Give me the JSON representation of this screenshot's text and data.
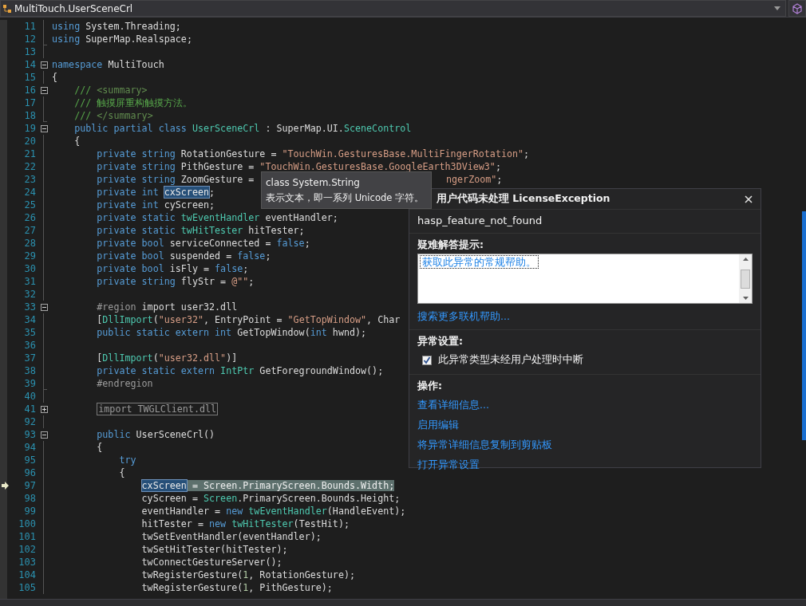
{
  "navigation_bar": {
    "member": "MultiTouch.UserSceneCrl"
  },
  "code_lines": [
    {
      "num": "11",
      "kind": "plain",
      "current": false,
      "tokens": [
        {
          "kind": "kw",
          "text": "using"
        },
        {
          "kind": "plain",
          "text": " System.Threading;"
        }
      ]
    },
    {
      "num": "12",
      "kind": "end",
      "current": false,
      "tokens": [
        {
          "kind": "kw",
          "text": "using"
        },
        {
          "kind": "plain",
          "text": " SuperMap.Realspace;"
        }
      ]
    },
    {
      "num": "13",
      "kind": "plain",
      "current": false
    },
    {
      "num": "14",
      "kind": "collapse",
      "current": false,
      "tokens": [
        {
          "kind": "kw",
          "text": "namespace"
        },
        {
          "kind": "plain",
          "text": " MultiTouch"
        }
      ]
    },
    {
      "num": "15",
      "kind": "plain",
      "current": false,
      "tokens": [
        {
          "kind": "plain",
          "text": "{"
        }
      ],
      "children": [
        {
          "num": "16",
          "kind": "collapse",
          "current": false,
          "tokens": [
            {
              "kind": "comment",
              "text": "/// "
            },
            {
              "kind": "doc",
              "text": "<summary>"
            }
          ]
        },
        {
          "num": "17",
          "kind": "plain",
          "current": false,
          "tokens": [
            {
              "kind": "comment",
              "text": "/// 触摸屏重构触摸方法。"
            }
          ]
        },
        {
          "num": "18",
          "kind": "end",
          "current": false,
          "tokens": [
            {
              "kind": "comment",
              "text": "/// "
            },
            {
              "kind": "doc",
              "text": "</summary>"
            }
          ]
        },
        {
          "num": "19",
          "kind": "collapse",
          "current": false,
          "tokens": [
            {
              "kind": "kw",
              "text": "public partial class"
            },
            {
              "kind": "type",
              "text": " UserSceneCrl"
            },
            {
              "kind": "plain",
              "text": " : SuperMap.UI."
            },
            {
              "kind": "type",
              "text": "SceneControl"
            }
          ]
        },
        {
          "num": "20",
          "kind": "plain",
          "current": false,
          "tokens": [
            {
              "kind": "plain",
              "text": "{"
            }
          ],
          "children": [
            {
              "num": "21",
              "kind": "plain",
              "current": false,
              "tokens": [
                {
                  "kind": "kw",
                  "text": "private string"
                },
                {
                  "kind": "plain",
                  "text": " RotationGesture = "
                },
                {
                  "kind": "str",
                  "text": "\"TouchWin.GesturesBase.MultiFingerRotation\""
                },
                {
                  "kind": "plain",
                  "text": ";"
                }
              ]
            },
            {
              "num": "22",
              "kind": "plain",
              "current": false,
              "tokens": [
                {
                  "kind": "kw",
                  "text": "private string"
                },
                {
                  "kind": "plain",
                  "text": " PithGesture = "
                },
                {
                  "kind": "str",
                  "text": "\"TouchWin.GesturesBase.GoogleEarth3DView3\""
                },
                {
                  "kind": "plain",
                  "text": ";"
                }
              ]
            },
            {
              "num": "23",
              "kind": "plain",
              "current": false,
              "tokens": [
                {
                  "kind": "kw",
                  "text": "private string"
                },
                {
                  "kind": "plain",
                  "text": " ZoomGesture ="
                }
              ],
              "tail": [
                {
                  "kind": "str",
                  "text": "ngerZoom\""
                },
                {
                  "kind": "plain",
                  "text": ";"
                }
              ]
            },
            {
              "num": "24",
              "kind": "plain",
              "current": false,
              "tokens": [
                {
                  "kind": "kw",
                  "text": "private int"
                },
                {
                  "kind": "sel",
                  "text": "cxScreen"
                },
                {
                  "kind": "plain",
                  "text": ";"
                }
              ]
            },
            {
              "num": "25",
              "kind": "plain",
              "current": false,
              "tokens": [
                {
                  "kind": "kw",
                  "text": "private int"
                },
                {
                  "kind": "plain",
                  "text": " cyScreen;"
                }
              ]
            },
            {
              "num": "26",
              "kind": "plain",
              "current": false,
              "tokens": [
                {
                  "kind": "kw",
                  "text": "private static"
                },
                {
                  "kind": "type",
                  "text": " twEventHandler"
                },
                {
                  "kind": "plain",
                  "text": " eventHandler;"
                }
              ]
            },
            {
              "num": "27",
              "kind": "plain",
              "current": false,
              "tokens": [
                {
                  "kind": "kw",
                  "text": "private static"
                },
                {
                  "kind": "type",
                  "text": " twHitTester"
                },
                {
                  "kind": "plain",
                  "text": " hitTester;"
                }
              ]
            },
            {
              "num": "28",
              "kind": "plain",
              "current": false,
              "tokens": [
                {
                  "kind": "kw",
                  "text": "private bool"
                },
                {
                  "kind": "plain",
                  "text": " serviceConnected = "
                },
                {
                  "kind": "kw",
                  "text": "false"
                },
                {
                  "kind": "plain",
                  "text": ";"
                }
              ]
            },
            {
              "num": "29",
              "kind": "plain",
              "current": false,
              "tokens": [
                {
                  "kind": "kw",
                  "text": "private bool"
                },
                {
                  "kind": "plain",
                  "text": " suspended = "
                },
                {
                  "kind": "kw",
                  "text": "false"
                },
                {
                  "kind": "plain",
                  "text": ";"
                }
              ]
            },
            {
              "num": "30",
              "kind": "plain",
              "current": false,
              "tokens": [
                {
                  "kind": "kw",
                  "text": "private bool"
                },
                {
                  "kind": "plain",
                  "text": " isFly = "
                },
                {
                  "kind": "kw",
                  "text": "false"
                },
                {
                  "kind": "plain",
                  "text": ";"
                }
              ]
            },
            {
              "num": "31",
              "kind": "plain",
              "current": false,
              "tokens": [
                {
                  "kind": "kw",
                  "text": "private string"
                },
                {
                  "kind": "plain",
                  "text": " flyStr = "
                },
                {
                  "kind": "str",
                  "text": "@\"\""
                },
                {
                  "kind": "plain",
                  "text": ";"
                }
              ]
            },
            {
              "num": "32",
              "kind": "plain",
              "current": false
            },
            {
              "num": "33",
              "kind": "collapse",
              "current": false,
              "tokens": [
                {
                  "kind": "pre",
                  "text": "#region"
                },
                {
                  "kind": "plain",
                  "text": " import user32.dll"
                }
              ]
            },
            {
              "num": "34",
              "kind": "plain",
              "current": false,
              "tokens": [
                {
                  "kind": "plain",
                  "text": "["
                },
                {
                  "kind": "type",
                  "text": "DllImport"
                },
                {
                  "kind": "plain",
                  "text": "("
                },
                {
                  "kind": "str",
                  "text": "\"user32\""
                },
                {
                  "kind": "plain",
                  "text": ", EntryPoint = "
                },
                {
                  "kind": "str",
                  "text": "\"GetTopWindow\""
                },
                {
                  "kind": "plain",
                  "text": ", Char"
                }
              ]
            },
            {
              "num": "35",
              "kind": "plain",
              "current": false,
              "tokens": [
                {
                  "kind": "kw",
                  "text": "public static extern int"
                },
                {
                  "kind": "plain",
                  "text": " GetTopWindow("
                },
                {
                  "kind": "kw",
                  "text": "int"
                },
                {
                  "kind": "plain",
                  "text": " hwnd);"
                }
              ]
            },
            {
              "num": "36",
              "kind": "plain",
              "current": false
            },
            {
              "num": "37",
              "kind": "plain",
              "current": false,
              "tokens": [
                {
                  "kind": "plain",
                  "text": "["
                },
                {
                  "kind": "type",
                  "text": "DllImport"
                },
                {
                  "kind": "plain",
                  "text": "("
                },
                {
                  "kind": "str",
                  "text": "\"user32.dll\""
                },
                {
                  "kind": "plain",
                  "text": ")]"
                }
              ]
            },
            {
              "num": "38",
              "kind": "plain",
              "current": false,
              "tokens": [
                {
                  "kind": "kw",
                  "text": "private static extern"
                },
                {
                  "kind": "type",
                  "text": " IntPtr"
                },
                {
                  "kind": "plain",
                  "text": " GetForegroundWindow();"
                }
              ]
            },
            {
              "num": "39",
              "kind": "end",
              "current": false,
              "tokens": [
                {
                  "kind": "pre",
                  "text": "#endregion"
                }
              ]
            },
            {
              "num": "40",
              "kind": "plain",
              "current": false
            },
            {
              "num": "41",
              "kind": "expand",
              "current": false,
              "tokens": [
                {
                  "kind": "collapsed",
                  "text": "import TWGLClient.dll"
                }
              ]
            },
            {
              "num": "92",
              "kind": "plain",
              "current": false
            },
            {
              "num": "93",
              "kind": "collapse",
              "current": false,
              "tokens": [
                {
                  "kind": "kw",
                  "text": "public"
                },
                {
                  "kind": "plain",
                  "text": " UserSceneCrl()"
                }
              ]
            },
            {
              "num": "94",
              "kind": "plain",
              "current": false,
              "tokens": [
                {
                  "kind": "plain",
                  "text": "{"
                }
              ],
              "children": [
                {
                  "num": "95",
                  "kind": "plain",
                  "current": false,
                  "tokens": [
                    {
                      "kind": "kw",
                      "text": "try"
                    }
                  ]
                },
                {
                  "num": "96",
                  "kind": "plain",
                  "current": false,
                  "tokens": [
                    {
                      "kind": "plain",
                      "text": "{"
                    }
                  ],
                  "children": [
                    {
                      "num": "97",
                      "kind": "plain",
                      "current": true,
                      "tokens": [
                        {
                          "kind": "sel",
                          "text": "cxScreen"
                        },
                        {
                          "kind": "cur",
                          "text": " = Screen.PrimaryScreen.Bounds.Width;"
                        }
                      ]
                    },
                    {
                      "num": "98",
                      "kind": "plain",
                      "current": false,
                      "tokens": [
                        {
                          "kind": "plain",
                          "text": "cyScreen = "
                        },
                        {
                          "kind": "type",
                          "text": "Screen"
                        },
                        {
                          "kind": "plain",
                          "text": ".PrimaryScreen.Bounds.Height;"
                        }
                      ]
                    },
                    {
                      "num": "99",
                      "kind": "plain",
                      "current": false,
                      "tokens": [
                        {
                          "kind": "plain",
                          "text": "eventHandler = "
                        },
                        {
                          "kind": "kw",
                          "text": "new"
                        },
                        {
                          "kind": "type",
                          "text": " twEventHandler"
                        },
                        {
                          "kind": "plain",
                          "text": "(HandleEvent);"
                        }
                      ]
                    },
                    {
                      "num": "100",
                      "kind": "plain",
                      "current": false,
                      "tokens": [
                        {
                          "kind": "plain",
                          "text": "hitTester = "
                        },
                        {
                          "kind": "kw",
                          "text": "new"
                        },
                        {
                          "kind": "type",
                          "text": " twHitTester"
                        },
                        {
                          "kind": "plain",
                          "text": "(TestHit);"
                        }
                      ]
                    },
                    {
                      "num": "101",
                      "kind": "plain",
                      "current": false,
                      "tokens": [
                        {
                          "kind": "plain",
                          "text": "twSetEventHandler(eventHandler);"
                        }
                      ]
                    },
                    {
                      "num": "102",
                      "kind": "plain",
                      "current": false,
                      "tokens": [
                        {
                          "kind": "plain",
                          "text": "twSetHitTester(hitTester);"
                        }
                      ]
                    },
                    {
                      "num": "103",
                      "kind": "plain",
                      "current": false,
                      "tokens": [
                        {
                          "kind": "plain",
                          "text": "twConnectGestureServer();"
                        }
                      ]
                    },
                    {
                      "num": "104",
                      "kind": "plain",
                      "current": false,
                      "tokens": [
                        {
                          "kind": "plain",
                          "text": "twRegisterGesture("
                        },
                        {
                          "kind": "num",
                          "text": "1"
                        },
                        {
                          "kind": "plain",
                          "text": ", RotationGesture);"
                        }
                      ]
                    },
                    {
                      "num": "105",
                      "kind": "plain",
                      "current": false,
                      "tokens": [
                        {
                          "kind": "plain",
                          "text": "twRegisterGesture("
                        },
                        {
                          "kind": "num",
                          "text": "1"
                        },
                        {
                          "kind": "plain",
                          "text": ", PithGesture);"
                        }
                      ]
                    }
                  ]
                }
              ]
            }
          ]
        }
      ]
    }
  ],
  "tooltip": {
    "signature": "class System.String",
    "description": "表示文本，即一系列 Unicode 字符。"
  },
  "exception_helper": {
    "title": "用户代码未处理 LicenseException",
    "message": "hasp_feature_not_found",
    "troubleshooting": {
      "heading": "疑难解答提示:",
      "tips": [
        "获取此异常的常规帮助。"
      ],
      "search_link": "搜索更多联机帮助..."
    },
    "settings": {
      "heading": "异常设置:",
      "break_option": {
        "label": "此异常类型未经用户处理时中断",
        "checked": true
      }
    },
    "actions": {
      "heading": "操作:",
      "links": [
        "查看详细信息...",
        "启用编辑",
        "将异常详细信息复制到剪贴板",
        "打开异常设置"
      ]
    }
  }
}
